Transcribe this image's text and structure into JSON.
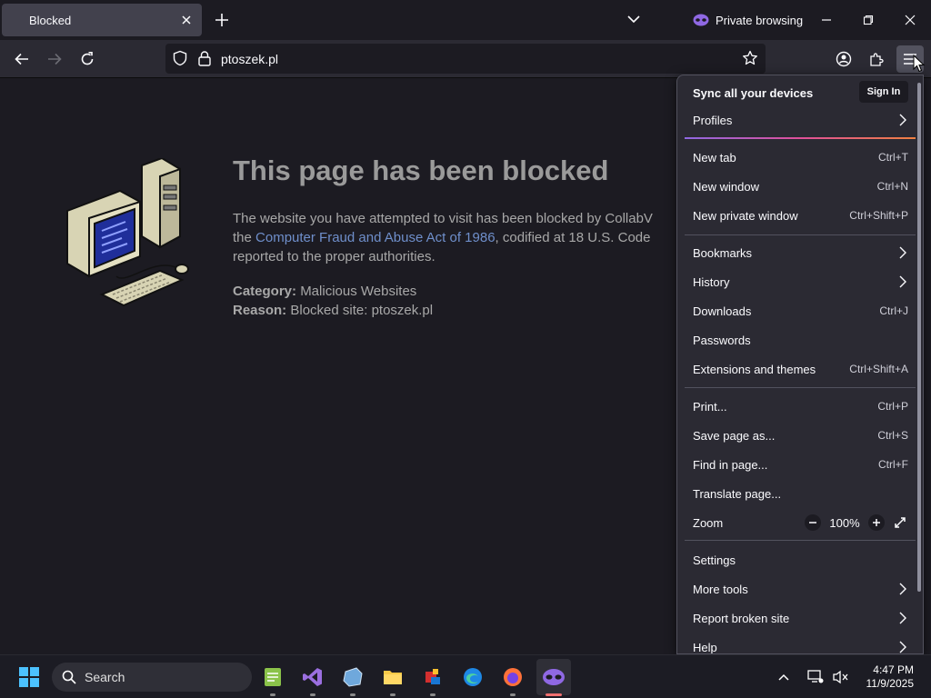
{
  "tab": {
    "title": "Blocked"
  },
  "private_label": "Private browsing",
  "nav": {
    "url": "ptoszek.pl"
  },
  "page": {
    "title": "This page has been blocked",
    "text_before": "The website you have attempted to visit has been blocked by CollabV",
    "text_the": "the ",
    "link": "Computer Fraud and Abuse Act of 1986",
    "text_after": ", codified at 18 U.S. Code",
    "text_line3": "reported to the proper authorities.",
    "category_label": "Category:",
    "category_value": "Malicious Websites",
    "reason_label": "Reason:",
    "reason_value": "Blocked site: ptoszek.pl"
  },
  "menu": {
    "sync": "Sync all your devices",
    "sign_in": "Sign In",
    "profiles": "Profiles",
    "new_tab": "New tab",
    "new_tab_sc": "Ctrl+T",
    "new_window": "New window",
    "new_window_sc": "Ctrl+N",
    "new_private": "New private window",
    "new_private_sc": "Ctrl+Shift+P",
    "bookmarks": "Bookmarks",
    "history": "History",
    "downloads": "Downloads",
    "downloads_sc": "Ctrl+J",
    "passwords": "Passwords",
    "extensions": "Extensions and themes",
    "extensions_sc": "Ctrl+Shift+A",
    "print": "Print...",
    "print_sc": "Ctrl+P",
    "save": "Save page as...",
    "save_sc": "Ctrl+S",
    "find": "Find in page...",
    "find_sc": "Ctrl+F",
    "translate": "Translate page...",
    "zoom": "Zoom",
    "zoom_level": "100%",
    "settings": "Settings",
    "more_tools": "More tools",
    "report": "Report broken site",
    "help": "Help"
  },
  "taskbar": {
    "search_placeholder": "Search",
    "time": "4:47 PM",
    "date": "11/9/2025"
  },
  "colors": {
    "accent": "#8f68e3",
    "link": "#6f8fcb"
  }
}
